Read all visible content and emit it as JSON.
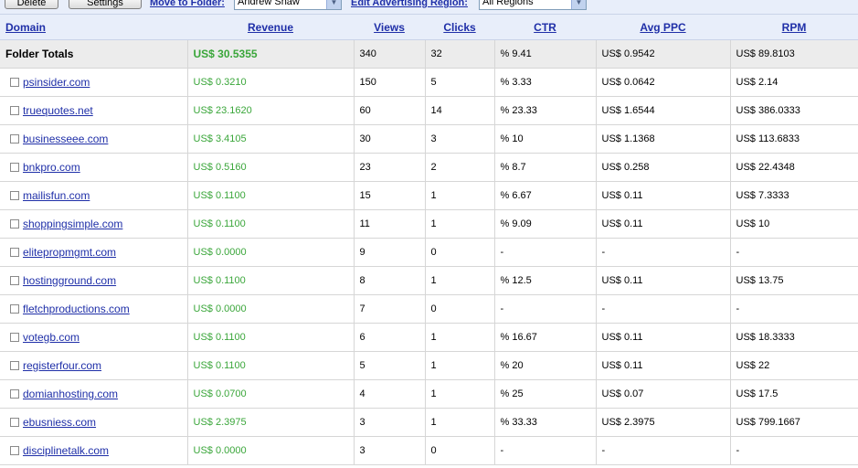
{
  "toolbar": {
    "delete_label": "Delete",
    "settings_label": "Settings",
    "move_label": "Move to Folder:",
    "folder_value": "Andrew Shaw",
    "region_label": "Edit Advertising Region:",
    "region_value": "All Regions"
  },
  "headers": [
    "Domain",
    "Revenue",
    "Views",
    "Clicks",
    "CTR",
    "Avg PPC",
    "RPM"
  ],
  "totals": {
    "label": "Folder Totals",
    "revenue": "US$ 30.5355",
    "views": "340",
    "clicks": "32",
    "ctr": "% 9.41",
    "ppc": "US$ 0.9542",
    "rpm": "US$ 89.8103"
  },
  "rows": [
    {
      "domain": "psinsider.com",
      "revenue": "US$ 0.3210",
      "views": "150",
      "clicks": "5",
      "ctr": "% 3.33",
      "ppc": "US$ 0.0642",
      "rpm": "US$ 2.14"
    },
    {
      "domain": "truequotes.net",
      "revenue": "US$ 23.1620",
      "views": "60",
      "clicks": "14",
      "ctr": "% 23.33",
      "ppc": "US$ 1.6544",
      "rpm": "US$ 386.0333"
    },
    {
      "domain": "businesseee.com",
      "revenue": "US$ 3.4105",
      "views": "30",
      "clicks": "3",
      "ctr": "% 10",
      "ppc": "US$ 1.1368",
      "rpm": "US$ 113.6833"
    },
    {
      "domain": "bnkpro.com",
      "revenue": "US$ 0.5160",
      "views": "23",
      "clicks": "2",
      "ctr": "% 8.7",
      "ppc": "US$ 0.258",
      "rpm": "US$ 22.4348"
    },
    {
      "domain": "mailisfun.com",
      "revenue": "US$ 0.1100",
      "views": "15",
      "clicks": "1",
      "ctr": "% 6.67",
      "ppc": "US$ 0.11",
      "rpm": "US$ 7.3333"
    },
    {
      "domain": "shoppingsimple.com",
      "revenue": "US$ 0.1100",
      "views": "11",
      "clicks": "1",
      "ctr": "% 9.09",
      "ppc": "US$ 0.11",
      "rpm": "US$ 10"
    },
    {
      "domain": "elitepropmgmt.com",
      "revenue": "US$ 0.0000",
      "views": "9",
      "clicks": "0",
      "ctr": "-",
      "ppc": "-",
      "rpm": "-"
    },
    {
      "domain": "hostingground.com",
      "revenue": "US$ 0.1100",
      "views": "8",
      "clicks": "1",
      "ctr": "% 12.5",
      "ppc": "US$ 0.11",
      "rpm": "US$ 13.75"
    },
    {
      "domain": "fletchproductions.com",
      "revenue": "US$ 0.0000",
      "views": "7",
      "clicks": "0",
      "ctr": "-",
      "ppc": "-",
      "rpm": "-"
    },
    {
      "domain": "votegb.com",
      "revenue": "US$ 0.1100",
      "views": "6",
      "clicks": "1",
      "ctr": "% 16.67",
      "ppc": "US$ 0.11",
      "rpm": "US$ 18.3333"
    },
    {
      "domain": "registerfour.com",
      "revenue": "US$ 0.1100",
      "views": "5",
      "clicks": "1",
      "ctr": "% 20",
      "ppc": "US$ 0.11",
      "rpm": "US$ 22"
    },
    {
      "domain": "domianhosting.com",
      "revenue": "US$ 0.0700",
      "views": "4",
      "clicks": "1",
      "ctr": "% 25",
      "ppc": "US$ 0.07",
      "rpm": "US$ 17.5"
    },
    {
      "domain": "ebusniess.com",
      "revenue": "US$ 2.3975",
      "views": "3",
      "clicks": "1",
      "ctr": "% 33.33",
      "ppc": "US$ 2.3975",
      "rpm": "US$ 799.1667"
    },
    {
      "domain": "disciplinetalk.com",
      "revenue": "US$ 0.0000",
      "views": "3",
      "clicks": "0",
      "ctr": "-",
      "ppc": "-",
      "rpm": "-"
    }
  ],
  "colors": {
    "link": "#1f2fa8",
    "revenue": "#3aa63a",
    "header_bg": "#e8eefa",
    "totals_bg": "#ececec"
  }
}
